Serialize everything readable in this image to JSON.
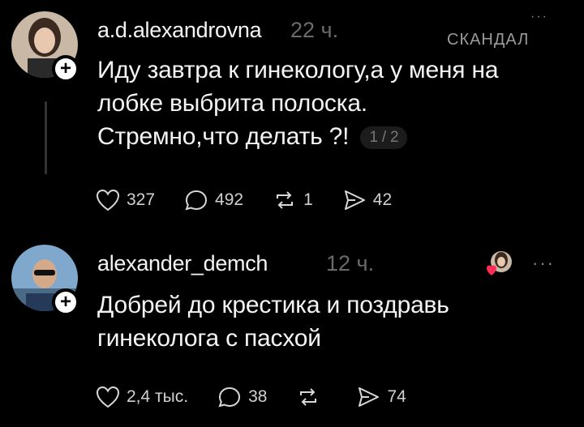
{
  "posts": [
    {
      "username": "a.d.alexandrovna",
      "time": "22 ч.",
      "tag": "СКАНДАЛ",
      "lines": [
        "Иду завтра к гинекологу,а у меня на",
        "лобке выбрита полоска.",
        "Стремно,что делать ?!"
      ],
      "page": "1 / 2",
      "likes": "327",
      "comments": "492",
      "reposts": "1",
      "shares": "42"
    },
    {
      "username": "alexander_demch",
      "time": "12 ч.",
      "more": "···",
      "lines": [
        "Добрей до крестика и поздравь",
        "гинеколога с пасхой"
      ],
      "likes": "2,4 тыс.",
      "comments": "38",
      "reposts": "",
      "shares": "74"
    }
  ],
  "icons": {
    "like": "heart-icon",
    "comment": "comment-icon",
    "repost": "repost-icon",
    "share": "send-icon",
    "follow": "plus-icon"
  }
}
